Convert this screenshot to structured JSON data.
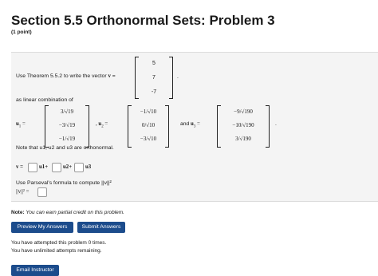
{
  "header": {
    "title": "Section 5.5 Orthonormal Sets: Problem 3",
    "points": "(1 point)"
  },
  "problem": {
    "intro_prefix": "Use Theorem 5.5.2 to write the vector ",
    "intro_vec": "v",
    "intro_eq": "=",
    "vector_v": [
      "5",
      "7",
      "-7"
    ],
    "period": ".",
    "linear_text": "as linear combination of",
    "u1_label": "u",
    "u1_sub": "1",
    "u2_label": "u",
    "u2_sub": "2",
    "u3_label": "u",
    "u3_sub": "3",
    "eq": "=",
    "comma": ",",
    "and": "and",
    "u1": [
      "3/√19",
      "−3/√19",
      "−1/√19"
    ],
    "u2": [
      "−1/√10",
      "0/√10",
      "−3/√10"
    ],
    "u3": [
      "−9/√190",
      "−10/√190",
      "3/√190"
    ],
    "orthonormal_text": "Note that u1, u2 and u3 are orthonormal.",
    "combo_v": "v",
    "combo_eq": "=",
    "combo_u1": "u1",
    "combo_plus1": "+",
    "combo_u2": "u2",
    "combo_plus2": "+",
    "combo_u3": "u3",
    "parseval_text": "Use Parseval's formula to compute ||v||²",
    "norm_label": "||v||² ="
  },
  "note": {
    "label": "Note:",
    "text": "You can earn partial credit on this problem."
  },
  "buttons": {
    "preview": "Preview My Answers",
    "submit": "Submit Answers",
    "email": "Email Instructor"
  },
  "status": {
    "attempted": "You have attempted this problem 0 times.",
    "remaining": "You have unlimited attempts remaining."
  }
}
